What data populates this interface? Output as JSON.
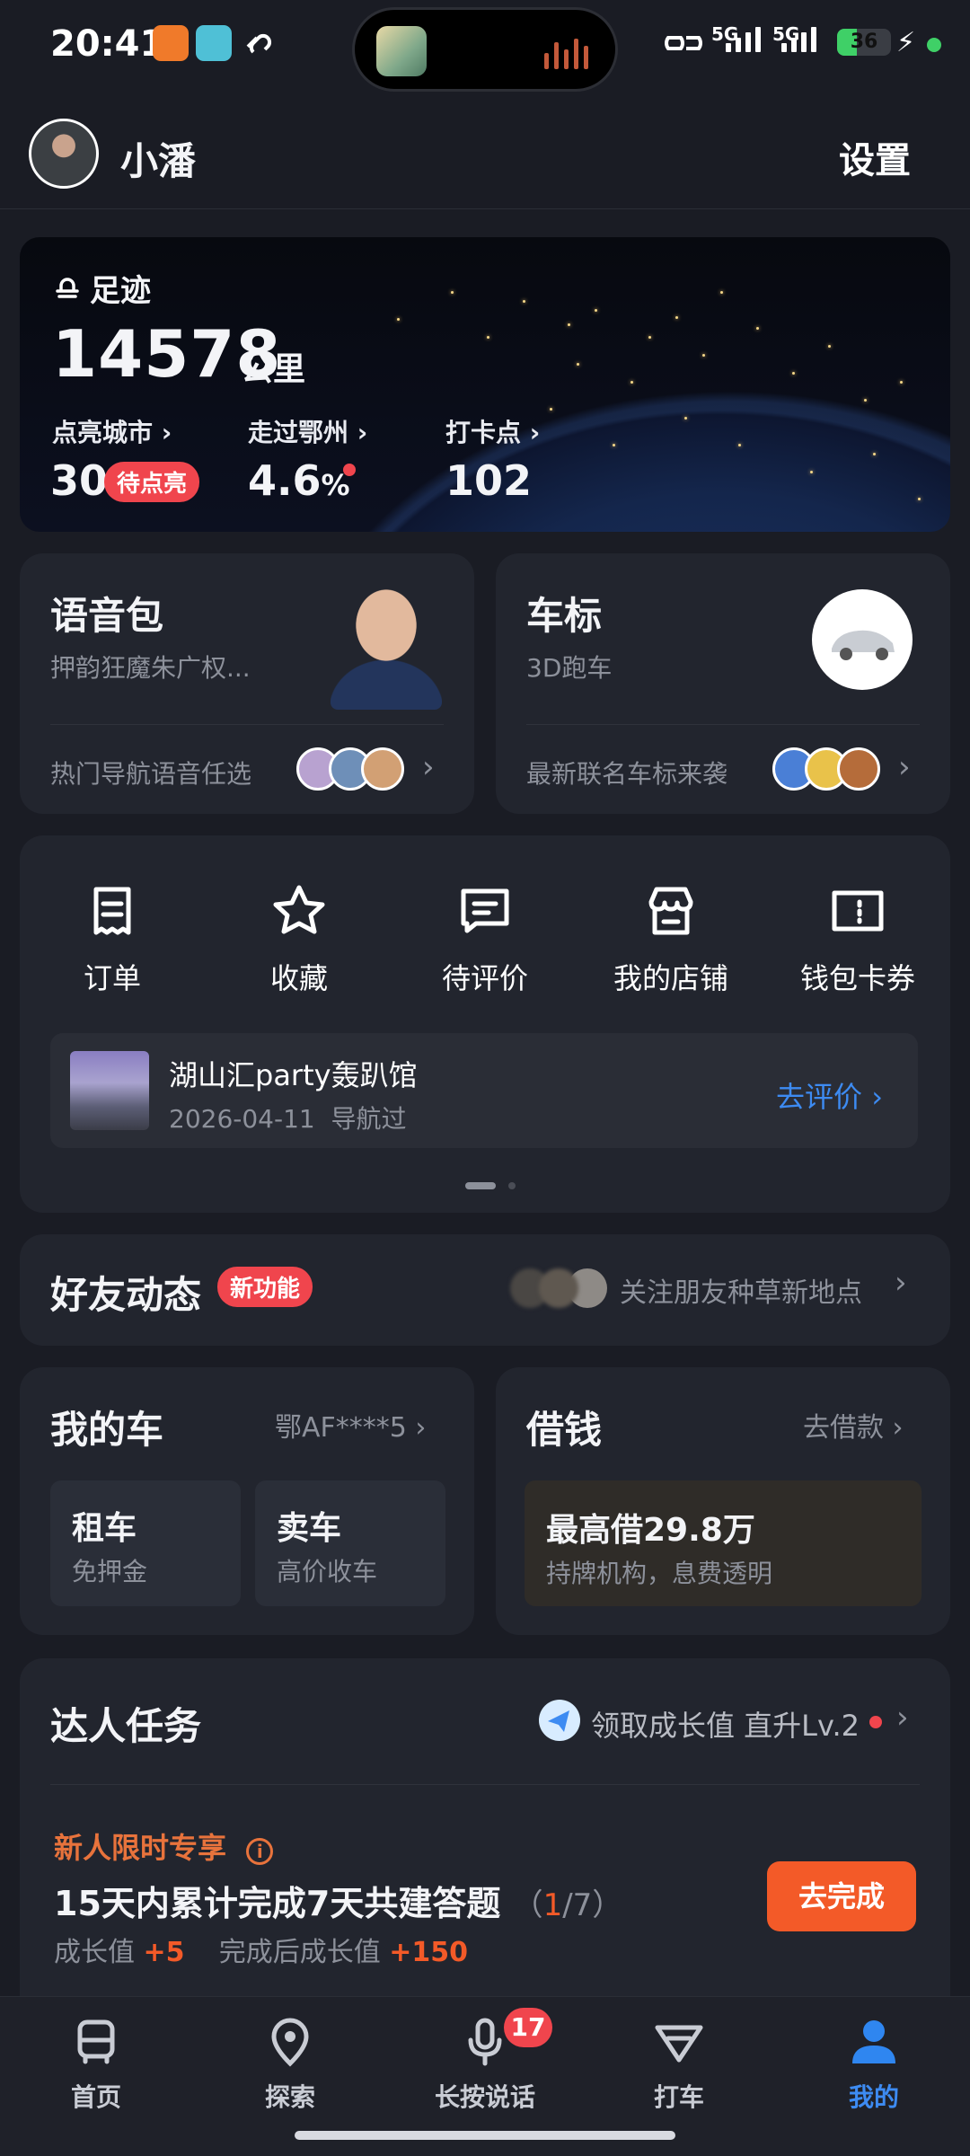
{
  "status_bar": {
    "time": "20:41",
    "battery": "36",
    "net1": "5G",
    "net2": "5G"
  },
  "header": {
    "username": "小潘",
    "settings": "设置"
  },
  "footprint": {
    "title": "足迹",
    "distance": "14578",
    "unit": "公里",
    "stats": [
      {
        "label": "点亮城市",
        "value": "30",
        "badge": "待点亮"
      },
      {
        "label": "走过鄂州",
        "value": "4.6",
        "unit": "%"
      },
      {
        "label": "打卡点",
        "value": "102"
      }
    ]
  },
  "voice_pack": {
    "title": "语音包",
    "subtitle": "押韵狂魔朱广权...",
    "footer": "热门导航语音任选"
  },
  "car_icon": {
    "title": "车标",
    "subtitle": "3D跑车",
    "footer": "最新联名车标来袭"
  },
  "quick_actions": [
    {
      "label": "订单",
      "icon": "receipt-icon"
    },
    {
      "label": "收藏",
      "icon": "star-icon"
    },
    {
      "label": "待评价",
      "icon": "comment-icon"
    },
    {
      "label": "我的店铺",
      "icon": "store-icon"
    },
    {
      "label": "钱包卡券",
      "icon": "wallet-icon"
    }
  ],
  "pending_review": {
    "place": "湖山汇party轰趴馆",
    "date": "2026-04-11",
    "action_text": "导航过",
    "cta": "去评价"
  },
  "friends": {
    "title": "好友动态",
    "badge": "新功能",
    "hint": "关注朋友种草新地点"
  },
  "my_car": {
    "title": "我的车",
    "plate": "鄂AF****5",
    "tiles": [
      {
        "title": "租车",
        "sub": "免押金"
      },
      {
        "title": "卖车",
        "sub": "高价收车"
      }
    ]
  },
  "loan": {
    "title": "借钱",
    "link": "去借款",
    "headline": "最高借29.8万",
    "sub": "持牌机构，息费透明"
  },
  "tasks": {
    "title": "达人任务",
    "growth_link": "领取成长值 直升Lv.2",
    "promo": "新人限时专享",
    "task": "15天内累计完成7天共建答题",
    "progress_done": "1",
    "progress_total": "/7",
    "progress_fraction": 0.142,
    "reward_label": "成长值",
    "reward": "+5",
    "reward_after_label": "完成后成长值",
    "reward_after": "+150",
    "cta": "去完成"
  },
  "bottom_nav": [
    {
      "label": "首页",
      "icon": "bus-icon"
    },
    {
      "label": "探索",
      "icon": "location-pin-icon"
    },
    {
      "label": "长按说话",
      "icon": "microphone-icon",
      "badge": "17"
    },
    {
      "label": "打车",
      "icon": "taxi-icon"
    },
    {
      "label": "我的",
      "icon": "person-icon",
      "active": true
    }
  ],
  "colors": {
    "background": "#1a1c24",
    "card": "#22252e",
    "accent_blue": "#3d8bf2",
    "red": "#f0454d",
    "orange": "#f35a28"
  }
}
